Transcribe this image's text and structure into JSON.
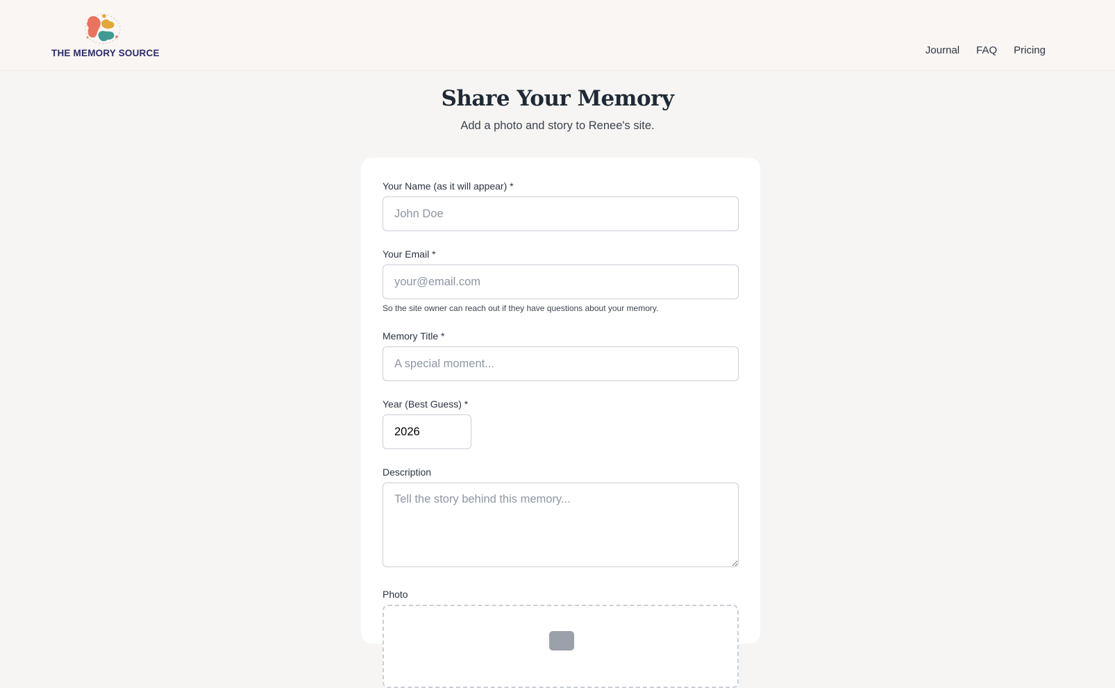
{
  "header": {
    "brand_name": "THE MEMORY SOURCE",
    "nav": [
      {
        "label": "Journal"
      },
      {
        "label": "FAQ"
      },
      {
        "label": "Pricing"
      }
    ]
  },
  "page": {
    "title": "Share Your Memory",
    "subtitle": "Add a photo and story to Renee's site."
  },
  "form": {
    "name": {
      "label": "Your Name (as it will appear) *",
      "placeholder": "John Doe",
      "value": ""
    },
    "email": {
      "label": "Your Email *",
      "placeholder": "your@email.com",
      "value": "",
      "help": "So the site owner can reach out if they have questions about your memory."
    },
    "title": {
      "label": "Memory Title *",
      "placeholder": "A special moment...",
      "value": ""
    },
    "year": {
      "label": "Year (Best Guess) *",
      "value": "2026"
    },
    "description": {
      "label": "Description",
      "placeholder": "Tell the story behind this memory...",
      "value": ""
    },
    "photo": {
      "label": "Photo",
      "icon": "upload-icon"
    }
  },
  "colors": {
    "background": "#f7f5f3",
    "brand_text": "#2b2a6b",
    "logo_coral": "#e8735f",
    "logo_gold": "#e0a838",
    "logo_teal": "#3f9a92",
    "input_border": "#c9ced6"
  }
}
